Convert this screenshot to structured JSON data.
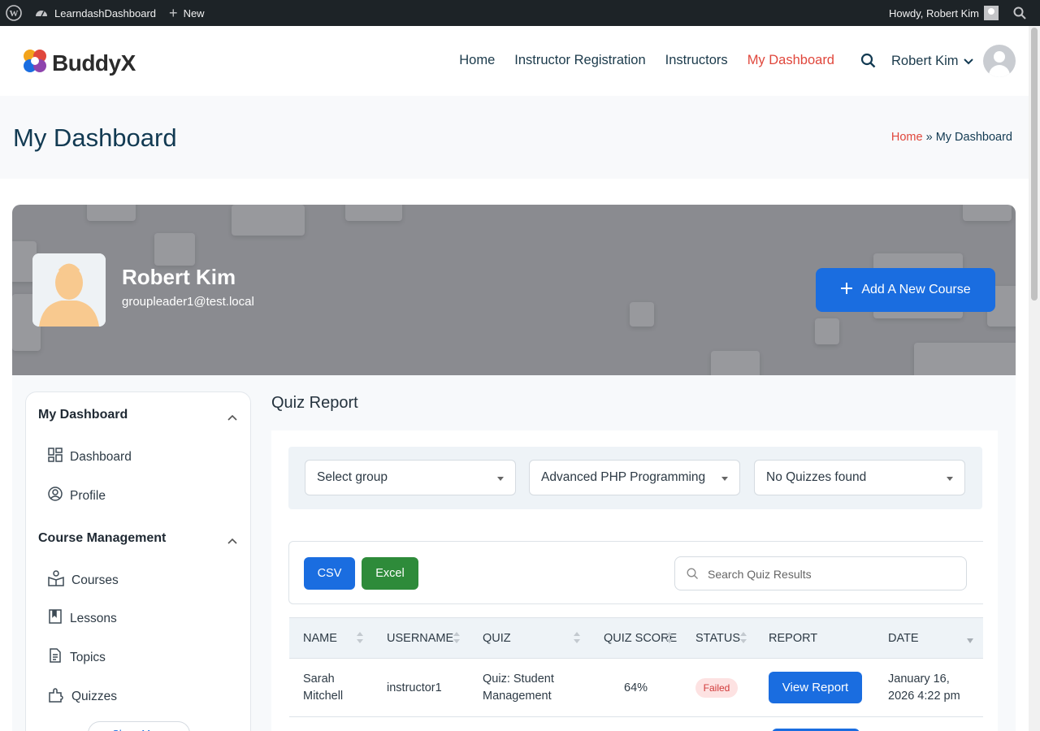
{
  "admin_bar": {
    "site_name": "LearndashDashboard",
    "new_label": "New",
    "greeting": "Howdy, Robert Kim"
  },
  "header": {
    "logo_text": "BuddyX",
    "nav": [
      "Home",
      "Instructor Registration",
      "Instructors",
      "My Dashboard"
    ],
    "active_nav": "My Dashboard",
    "user_name": "Robert Kim"
  },
  "page": {
    "title": "My Dashboard",
    "breadcrumb_home": "Home",
    "breadcrumb_sep": "»",
    "breadcrumb_current": "My Dashboard"
  },
  "profile": {
    "name": "Robert Kim",
    "email": "groupleader1@test.local",
    "add_course_label": "Add A New Course"
  },
  "sidebar": {
    "sections": [
      {
        "title": "My Dashboard",
        "items": [
          "Dashboard",
          "Profile"
        ]
      },
      {
        "title": "Course Management",
        "items": [
          "Courses",
          "Lessons",
          "Topics",
          "Quizzes"
        ]
      }
    ],
    "show_more": "Show More"
  },
  "quiz_report": {
    "title": "Quiz Report",
    "filters": {
      "group": "Select group",
      "course": "Advanced PHP Programming",
      "quiz": "No Quizzes found"
    },
    "export": {
      "csv": "CSV",
      "excel": "Excel"
    },
    "search_placeholder": "Search Quiz Results",
    "columns": [
      "NAME",
      "USERNAME",
      "QUIZ",
      "QUIZ SCORE",
      "STATUS",
      "REPORT",
      "DATE"
    ],
    "rows": [
      {
        "name_line1": "Sarah",
        "name_line2": "Mitchell",
        "username": "instructor1",
        "quiz_line1": "Quiz: Student",
        "quiz_line2": "Management",
        "score": "64%",
        "status": "Failed",
        "report": "View Report",
        "date_line1": "January 16,",
        "date_line2": "2026 4:22 pm"
      }
    ]
  },
  "colors": {
    "accent": "#1a6de0",
    "nav_active": "#e0473c",
    "excel": "#2e8b3a",
    "failed_bg": "#fde2e2",
    "failed_text": "#d13a3a"
  }
}
